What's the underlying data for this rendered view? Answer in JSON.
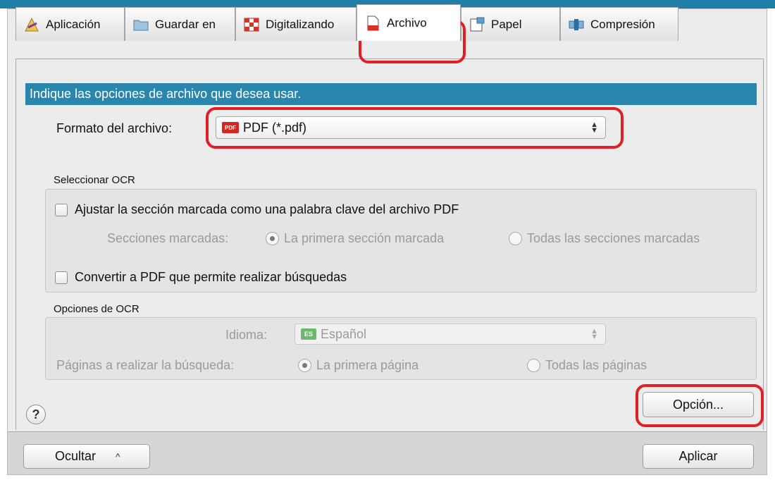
{
  "tabs": [
    {
      "label": "Aplicación",
      "icon": "application-icon"
    },
    {
      "label": "Guardar en",
      "icon": "folder-icon"
    },
    {
      "label": "Digitalizando",
      "icon": "scan-icon"
    },
    {
      "label": "Archivo",
      "icon": "file-icon",
      "active": true
    },
    {
      "label": "Papel",
      "icon": "paper-icon"
    },
    {
      "label": "Compresión",
      "icon": "compression-icon"
    }
  ],
  "banner": "Indique las opciones de archivo que desea usar.",
  "file_format": {
    "label": "Formato del archivo:",
    "value": "PDF (*.pdf)",
    "badge": "PDF"
  },
  "ocr_select": {
    "title": "Seleccionar OCR",
    "keyword_checkbox": "Ajustar la sección marcada como una palabra clave del archivo PDF",
    "sections_label": "Secciones marcadas:",
    "sections_option_first": "La primera sección marcada",
    "sections_option_all": "Todas las secciones marcadas",
    "searchable_checkbox": "Convertir a PDF que permite realizar búsquedas"
  },
  "ocr_options": {
    "title": "Opciones de OCR",
    "language_label": "Idioma:",
    "language_value": "Español",
    "language_badge": "ES",
    "pages_label": "Páginas a realizar la búsqueda:",
    "pages_option_first": "La primera página",
    "pages_option_all": "Todas las páginas"
  },
  "buttons": {
    "help": "?",
    "option": "Opción...",
    "hide": "Ocultar",
    "hide_caret": "^",
    "apply": "Aplicar"
  },
  "colors": {
    "accent": "#2a86ad",
    "highlight": "#e01f26"
  }
}
